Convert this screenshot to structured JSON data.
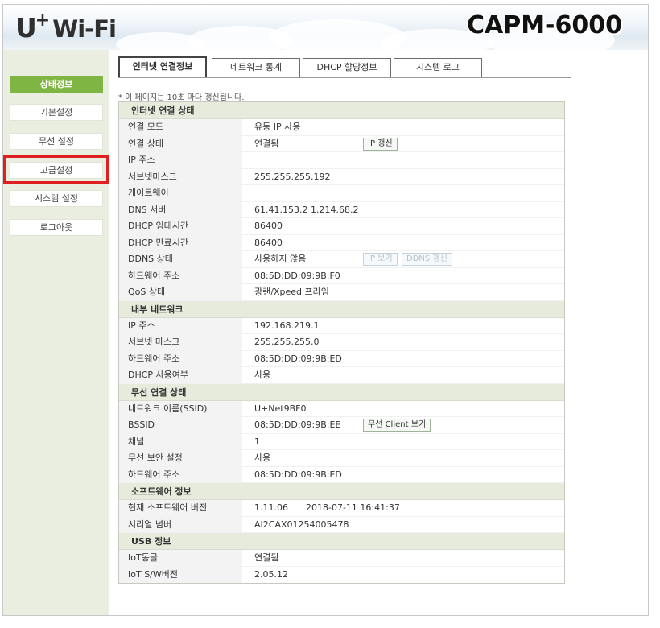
{
  "header": {
    "logo_u": "U",
    "logo_plus": "+",
    "logo_wifi": "Wi-Fi",
    "model": "CAPM-6000"
  },
  "sidebar": {
    "items": [
      {
        "label": "상태정보",
        "active": true
      },
      {
        "label": "기본설정"
      },
      {
        "label": "무선 설정"
      },
      {
        "label": "고급설정",
        "highlighted": true
      },
      {
        "label": "시스템 설정"
      },
      {
        "label": "로그아웃"
      }
    ]
  },
  "tabs": [
    {
      "label": "인터넷 연결정보",
      "active": true
    },
    {
      "label": "네트워크 통계"
    },
    {
      "label": "DHCP 할당정보"
    },
    {
      "label": "시스템 로그"
    }
  ],
  "notice": "* 이 페이지는 10초 마다 갱신됩니다.",
  "sections": {
    "internet": {
      "title": "인터넷 연결 상태",
      "rows": [
        {
          "label": "연결 모드",
          "value": "유동 IP 사용"
        },
        {
          "label": "연결 상태",
          "value": "연결됨",
          "button": "IP 갱신"
        },
        {
          "label": "IP 주소",
          "value": ""
        },
        {
          "label": "서브넷마스크",
          "value": "255.255.255.192"
        },
        {
          "label": "게이트웨이",
          "value": ""
        },
        {
          "label": "DNS 서버",
          "value": "61.41.153.2  1.214.68.2"
        },
        {
          "label": "DHCP 임대시간",
          "value": "86400"
        },
        {
          "label": "DHCP 만료시간",
          "value": "86400"
        },
        {
          "label": "DDNS 상태",
          "value": "사용하지 않음",
          "button": "IP 보기",
          "button2": "DDNS 갱신"
        },
        {
          "label": "하드웨어 주소",
          "value": "08:5D:DD:09:9B:F0"
        },
        {
          "label": "QoS 상태",
          "value": "광랜/Xpeed 프라임"
        }
      ]
    },
    "lan": {
      "title": "내부 네트워크",
      "rows": [
        {
          "label": "IP 주소",
          "value": "192.168.219.1"
        },
        {
          "label": "서브넷 마스크",
          "value": "255.255.255.0"
        },
        {
          "label": "하드웨어 주소",
          "value": "08:5D:DD:09:9B:ED"
        },
        {
          "label": "DHCP 사용여부",
          "value": "사용"
        }
      ]
    },
    "wireless": {
      "title": "무선 연결 상태",
      "rows": [
        {
          "label": "네트워크 이름(SSID)",
          "value": "U+Net9BF0"
        },
        {
          "label": "BSSID",
          "value": "08:5D:DD:09:9B:EE",
          "button": "무선 Client 보기"
        },
        {
          "label": "채널",
          "value": "1"
        },
        {
          "label": "무선 보안 설정",
          "value": "사용"
        },
        {
          "label": "하드웨어 주소",
          "value": "08:5D:DD:09:9B:ED"
        }
      ]
    },
    "software": {
      "title": "소프트웨어 정보",
      "rows": [
        {
          "label": "현재 소프트웨어 버전",
          "value": "1.11.06",
          "value2": "2018-07-11 16:41:37"
        },
        {
          "label": "시리얼 넘버",
          "value": "AI2CAX01254005478"
        }
      ]
    },
    "usb": {
      "title": "USB 정보",
      "rows": [
        {
          "label": "IoT동글",
          "value": "연결됨"
        },
        {
          "label": "IoT S/W버전",
          "value": "2.05.12"
        }
      ]
    }
  }
}
